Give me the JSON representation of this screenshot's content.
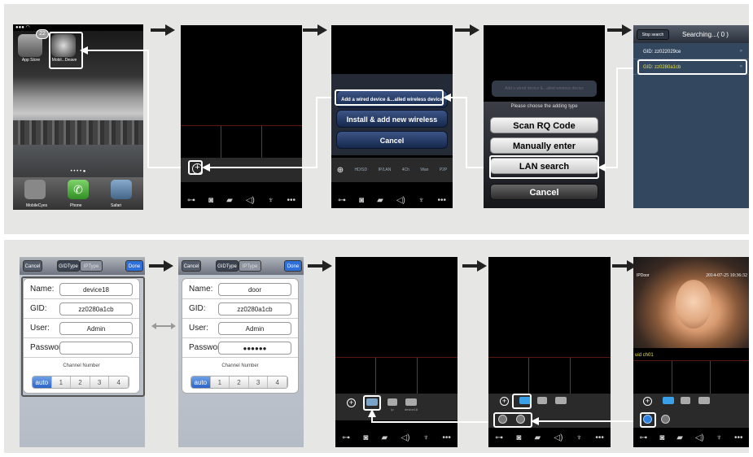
{
  "home": {
    "badge": "22",
    "app_store": "App Store",
    "mobile_eye": "Mobil...Deave",
    "dock_items": [
      "MobileCyes",
      "Phone",
      "Safari"
    ]
  },
  "add_menu": {
    "option1": "Add a wired device &...alled wireless device",
    "option2": "Install & add new wireless device",
    "cancel": "Cancel"
  },
  "add_type": {
    "prompt": "Please choose the adding type",
    "scan": "Scan RQ Code",
    "manual": "Manually enter",
    "lan": "LAN search",
    "cancel": "Cancel",
    "faded": "Add a wired device &...alled wireless device"
  },
  "search": {
    "stop": "Stop search",
    "title": "Searching...( 0 )",
    "results": [
      "GID: zz022029ce",
      "GID: zz0280a1cb"
    ]
  },
  "form1": {
    "cancel": "Cancel",
    "tab1": "GIDType",
    "tab2": "IPType",
    "done": "Done",
    "name_label": "Name:",
    "name": "device18",
    "gid_label": "GID:",
    "gid": "zz0280a1cb",
    "user_label": "User:",
    "user": "Admin",
    "password_label": "Password:",
    "password": "",
    "channel_label": "Channel Number",
    "channels": [
      "auto",
      "1",
      "2",
      "3",
      "4"
    ]
  },
  "form2": {
    "cancel": "Cancel",
    "tab1": "GIDType",
    "tab2": "IPType",
    "done": "Done",
    "name_label": "Name:",
    "name": "door",
    "gid_label": "GID:",
    "gid": "zz0280a1cb",
    "user_label": "User:",
    "user": "Admin",
    "password_label": "Password:",
    "password": "●●●●●●",
    "channel_label": "Channel Number",
    "channels": [
      "auto",
      "1",
      "2",
      "3",
      "4"
    ]
  },
  "devlist": {
    "dev_a": "uid",
    "dev_b": "ip",
    "dev_c": "device18",
    "small_labels": [
      "HD/SD",
      "IP/LAN",
      "4Ch",
      "Wan",
      "P2P"
    ]
  },
  "live": {
    "overlay_left": "IPDoor",
    "overlay_right": "2014-07-25 10:36:32",
    "channel": "uid ch01"
  },
  "colors": {
    "highlight": "#ffffff",
    "search_bg": "#33475f",
    "selected_text": "#e8e048"
  }
}
